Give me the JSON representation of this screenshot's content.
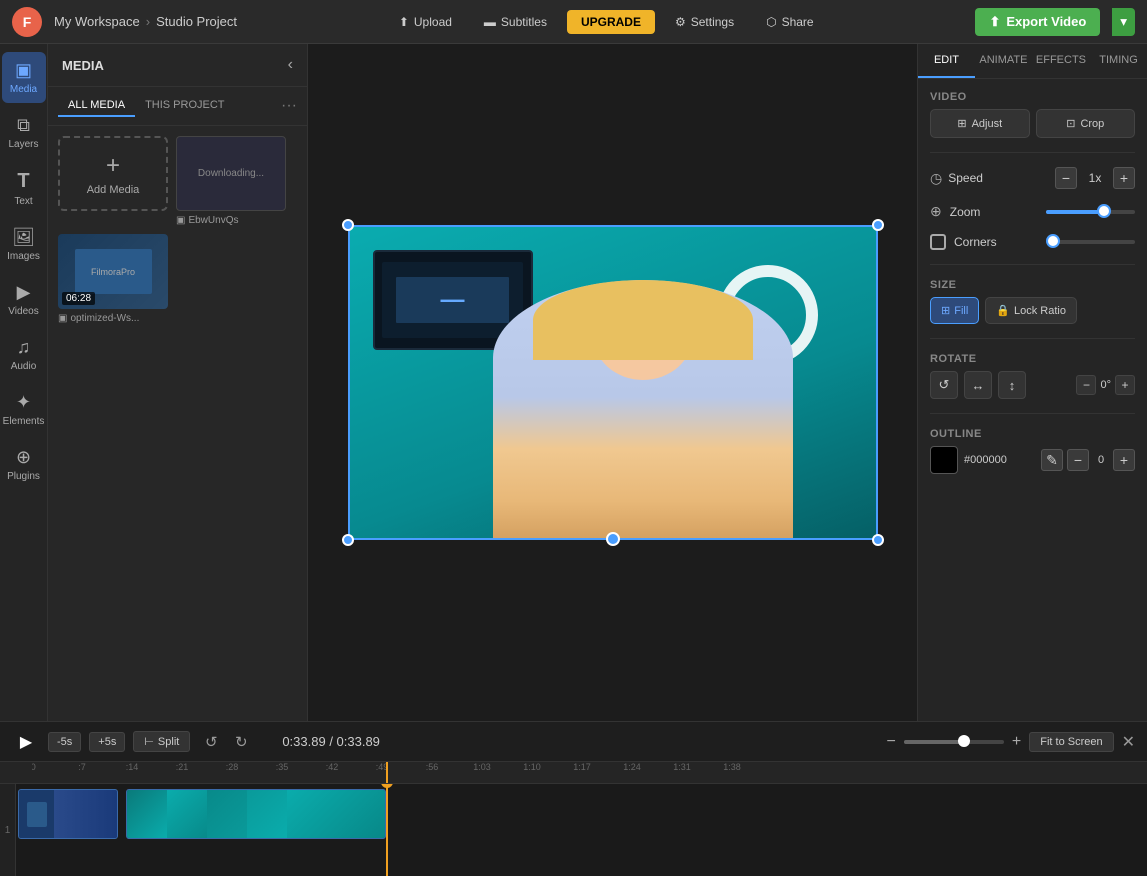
{
  "app": {
    "logo": "F",
    "workspace": "My Workspace",
    "project": "Studio Project",
    "separator": "›"
  },
  "topbar": {
    "upload_label": "Upload",
    "subtitles_label": "Subtitles",
    "upgrade_label": "UPGRADE",
    "settings_label": "Settings",
    "share_label": "Share",
    "export_label": "Export Video",
    "export_chevron": "▾"
  },
  "sidebar": {
    "items": [
      {
        "id": "media",
        "icon": "▣",
        "label": "Media"
      },
      {
        "id": "layers",
        "icon": "⧉",
        "label": "Layers"
      },
      {
        "id": "text",
        "icon": "T",
        "label": "Text"
      },
      {
        "id": "images",
        "icon": "🖼",
        "label": "Images"
      },
      {
        "id": "videos",
        "icon": "▶",
        "label": "Videos"
      },
      {
        "id": "audio",
        "icon": "♫",
        "label": "Audio"
      },
      {
        "id": "elements",
        "icon": "✦",
        "label": "Elements"
      },
      {
        "id": "plugins",
        "icon": "⊕",
        "label": "Plugins"
      }
    ]
  },
  "media_panel": {
    "title": "MEDIA",
    "tabs": [
      "ALL MEDIA",
      "THIS PROJECT"
    ],
    "active_tab": "ALL MEDIA",
    "add_media_label": "Add Media",
    "media_items": [
      {
        "id": 1,
        "name": "EbwUnvQs",
        "type": "downloading",
        "label": "Downloading..."
      },
      {
        "id": 2,
        "name": "optimized-Ws...",
        "duration": "06:28",
        "type": "video"
      }
    ]
  },
  "canvas": {
    "timecode": "0:33.89 / 0:33.89"
  },
  "right_panel": {
    "tabs": [
      "EDIT",
      "ANIMATE",
      "EFFECTS",
      "TIMING"
    ],
    "active_tab": "EDIT",
    "video_section": {
      "label": "VIDEO",
      "adjust_label": "Adjust",
      "crop_label": "Crop"
    },
    "speed": {
      "label": "Speed",
      "value": "1x",
      "minus": "−",
      "plus": "+"
    },
    "zoom": {
      "label": "Zoom",
      "value": 65
    },
    "corners": {
      "label": "Corners",
      "value": 5
    },
    "size": {
      "label": "SIZE",
      "fill_label": "Fill",
      "lock_ratio_label": "Lock Ratio"
    },
    "rotate": {
      "label": "ROTATE",
      "degree_value": "0°",
      "minus": "−",
      "plus": "+"
    },
    "outline": {
      "label": "OUTLINE",
      "color": "#000000",
      "hex": "#000000",
      "value": "0"
    }
  },
  "timeline": {
    "play_icon": "▶",
    "skip_back": "-5s",
    "skip_forward": "+5s",
    "split_label": "Split",
    "undo_icon": "↺",
    "redo_icon": "↻",
    "timecode": "0:33.89 / 0:33.89",
    "fit_screen_label": "Fit to Screen",
    "ruler_marks": [
      ":0",
      ":7",
      ":14",
      ":21",
      ":28",
      ":35",
      ":42",
      ":49",
      ":56",
      "1:03",
      "1:10",
      "1:17",
      "1:24",
      "1:31",
      "1:38"
    ],
    "track_number": "1"
  }
}
